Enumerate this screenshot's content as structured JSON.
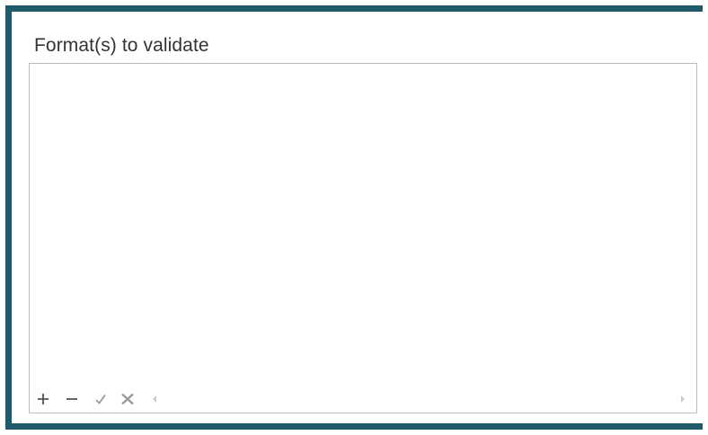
{
  "panel": {
    "label": "Format(s) to validate",
    "accent_color": "#1f5a6b"
  },
  "list": {
    "items": []
  },
  "toolbar": {
    "add_icon": "plus-icon",
    "remove_icon": "minus-icon",
    "confirm_icon": "check-icon",
    "cancel_icon": "x-icon",
    "scroll_left_icon": "caret-left-icon",
    "scroll_right_icon": "caret-right-icon"
  }
}
